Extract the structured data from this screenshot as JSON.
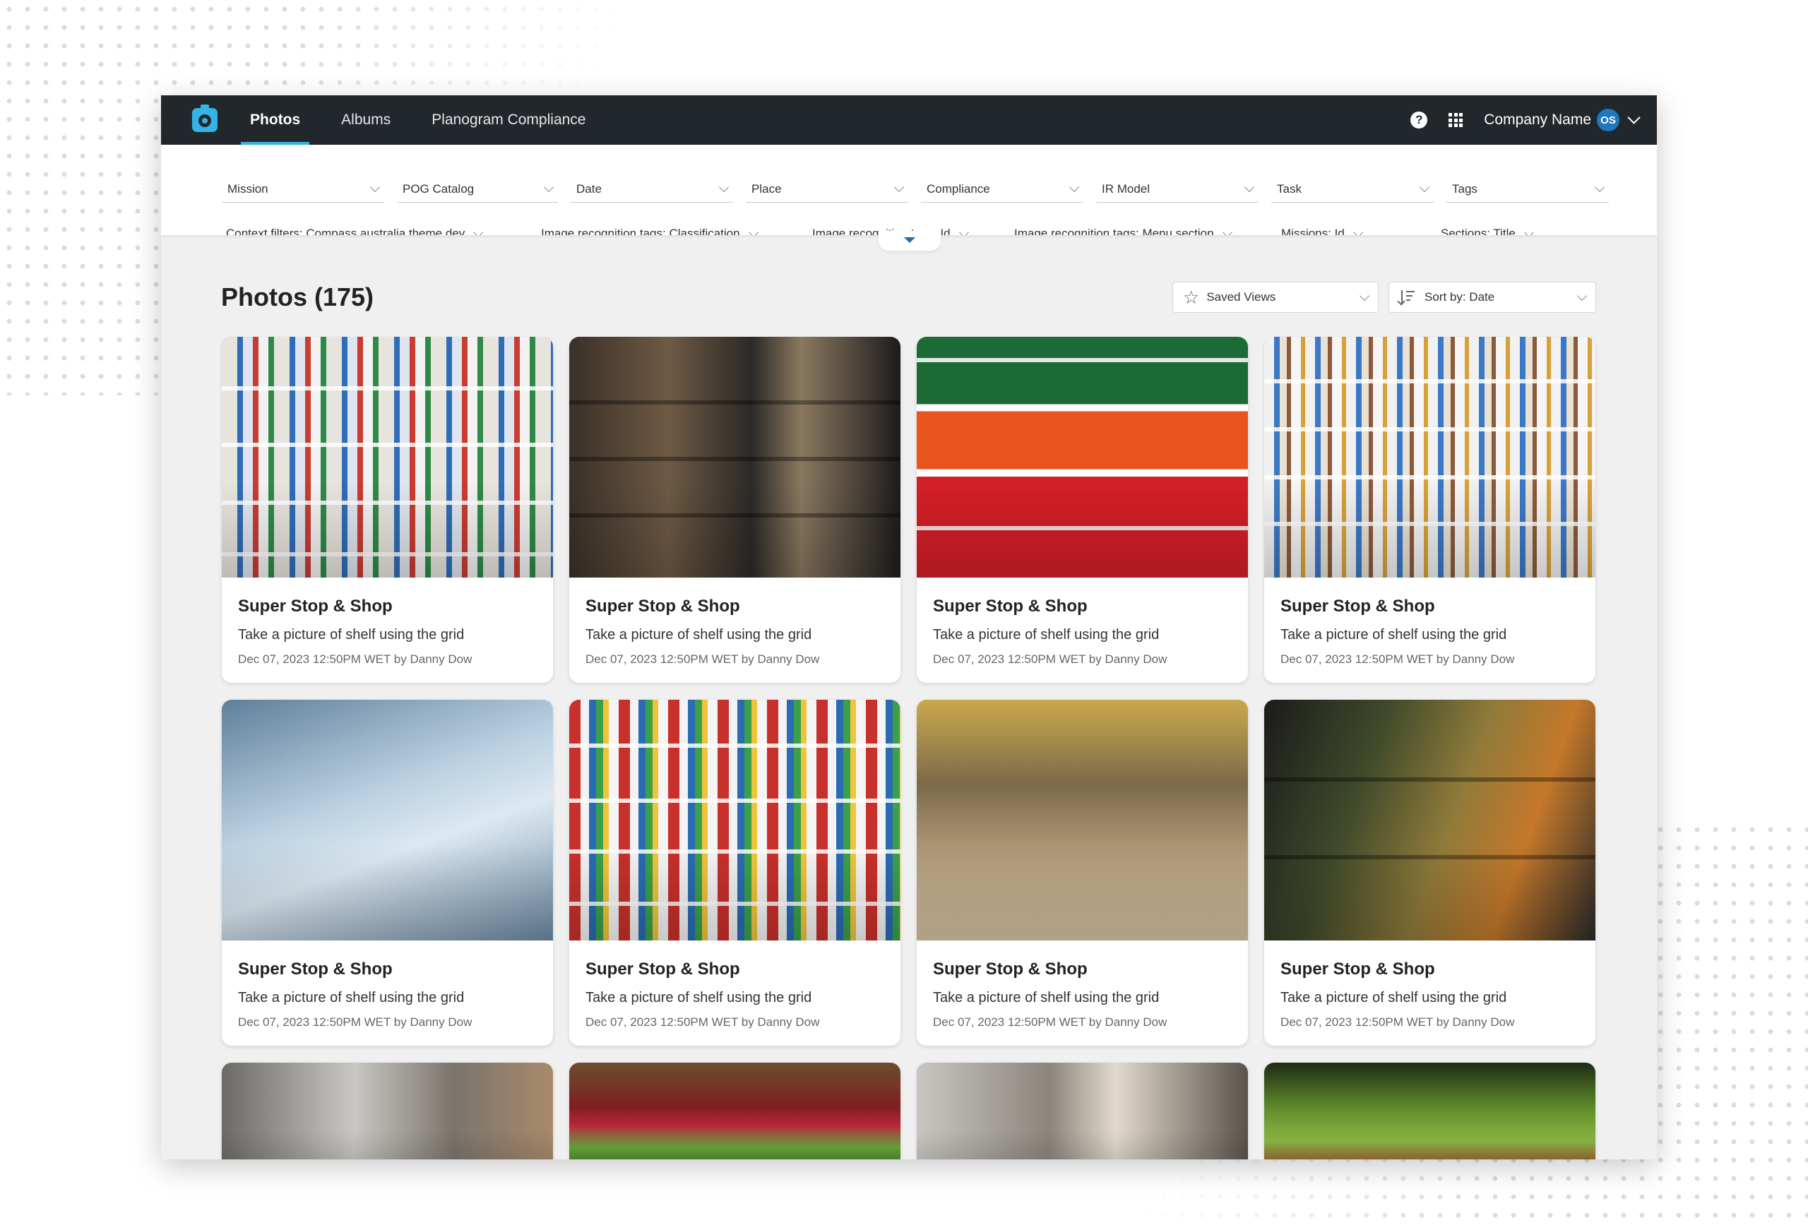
{
  "nav": {
    "tabs": [
      {
        "label": "Photos",
        "active": true
      },
      {
        "label": "Albums",
        "active": false
      },
      {
        "label": "Planogram Compliance",
        "active": false
      }
    ],
    "company_name": "Company Name",
    "avatar_initials": "OS",
    "help_glyph": "?"
  },
  "filters": {
    "primary": [
      "Mission",
      "POG Catalog",
      "Date",
      "Place",
      "Compliance",
      "IR Model",
      "Task",
      "Tags"
    ],
    "context": [
      "Context filters: Compass australia theme dev",
      "Image recognition tags: Classification",
      "Image recognition tags: Id",
      "Image recognition tags: Menu section",
      "Missions: Id",
      "Sections: Title"
    ]
  },
  "main": {
    "title": "Photos (175)",
    "saved_views_label": "Saved Views",
    "sort_label": "Sort by: Date"
  },
  "photos": [
    {
      "store": "Super Stop & Shop",
      "task": "Take a picture of shelf using the grid",
      "meta": "Dec 07, 2023 12:50PM WET by Danny Dow"
    },
    {
      "store": "Super Stop & Shop",
      "task": "Take a picture of shelf using the grid",
      "meta": "Dec 07, 2023 12:50PM WET by Danny Dow"
    },
    {
      "store": "Super Stop & Shop",
      "task": "Take a picture of shelf using the grid",
      "meta": "Dec 07, 2023 12:50PM WET by Danny Dow"
    },
    {
      "store": "Super Stop & Shop",
      "task": "Take a picture of shelf using the grid",
      "meta": "Dec 07, 2023 12:50PM WET by Danny Dow"
    },
    {
      "store": "Super Stop & Shop",
      "task": "Take a picture of shelf using the grid",
      "meta": "Dec 07, 2023 12:50PM WET by Danny Dow"
    },
    {
      "store": "Super Stop & Shop",
      "task": "Take a picture of shelf using the grid",
      "meta": "Dec 07, 2023 12:50PM WET by Danny Dow"
    },
    {
      "store": "Super Stop & Shop",
      "task": "Take a picture of shelf using the grid",
      "meta": "Dec 07, 2023 12:50PM WET by Danny Dow"
    },
    {
      "store": "Super Stop & Shop",
      "task": "Take a picture of shelf using the grid",
      "meta": "Dec 07, 2023 12:50PM WET by Danny Dow"
    }
  ],
  "colors": {
    "header_bg": "#22272b",
    "accent": "#34b3e6",
    "avatar_bg": "#1e78c2",
    "page_bg": "#f0f0f0"
  }
}
